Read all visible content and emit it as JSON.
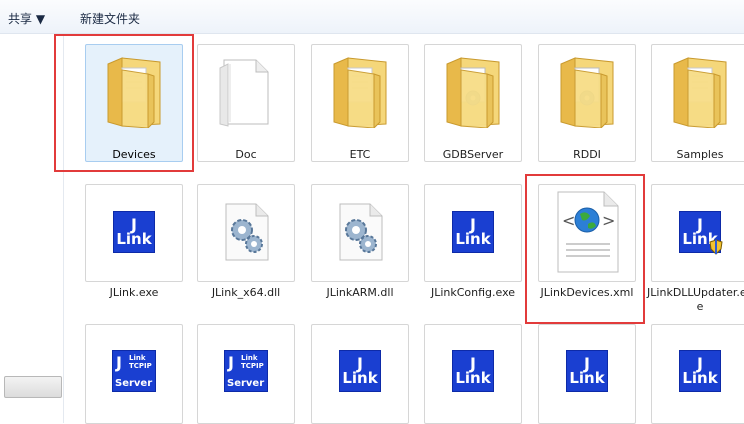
{
  "toolbar": {
    "share_label": "共享 ▼",
    "new_folder_label": "新建文件夹"
  },
  "row1": [
    {
      "name": "Devices",
      "kind": "folder",
      "selected": true
    },
    {
      "name": "Doc",
      "kind": "folder-doc"
    },
    {
      "name": "ETC",
      "kind": "folder"
    },
    {
      "name": "GDBServer",
      "kind": "folder-gear"
    },
    {
      "name": "RDDI",
      "kind": "folder-gear"
    },
    {
      "name": "Samples",
      "kind": "folder"
    }
  ],
  "row2": [
    {
      "name": "JLink.exe",
      "kind": "jlink"
    },
    {
      "name": "JLink_x64.dll",
      "kind": "dll"
    },
    {
      "name": "JLinkARM.dll",
      "kind": "dll"
    },
    {
      "name": "JLinkConfig.exe",
      "kind": "jlink"
    },
    {
      "name": "JLinkDevices.xml",
      "kind": "xml"
    },
    {
      "name": "JLinkDLLUpdater.exe",
      "kind": "jlink-shield"
    }
  ],
  "row3": [
    {
      "kind": "jlink-server"
    },
    {
      "kind": "jlink-server"
    },
    {
      "kind": "jlink"
    },
    {
      "kind": "jlink"
    },
    {
      "kind": "jlink"
    },
    {
      "kind": "jlink"
    }
  ],
  "icon_text": {
    "j": "J",
    "link": "Link",
    "link_small": "Link",
    "tcpip": "TCPIP",
    "server": "Server"
  },
  "colors": {
    "highlight": "#e23b3b",
    "jlink_blue": "#1a3fd1",
    "folder": "#f1cf6a"
  }
}
